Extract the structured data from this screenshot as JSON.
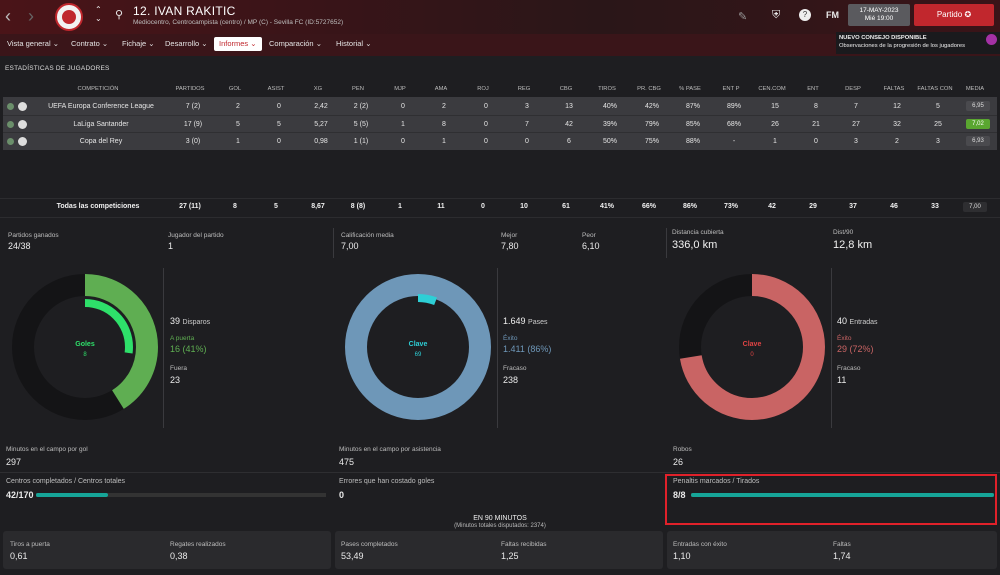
{
  "header": {
    "player_name": "12. IVAN RAKITIC",
    "player_sub": "Mediocentro, Centrocampista (centro) / MP (C) - Sevilla FC (ID:5727652)",
    "date_line1": "17-MAY-2023",
    "date_line2": "Mié 19:00",
    "partido_label": "Partido",
    "fm_label": "FM"
  },
  "menu": [
    {
      "label": "Vista general",
      "chev": "⌄"
    },
    {
      "label": "Contrato",
      "chev": "⌄"
    },
    {
      "label": "Fichaje",
      "chev": "⌄"
    },
    {
      "label": "Desarrollo",
      "chev": "⌄"
    },
    {
      "label": "Informes",
      "chev": "⌄"
    },
    {
      "label": "Comparación",
      "chev": "⌄"
    },
    {
      "label": "Historial",
      "chev": "⌄"
    }
  ],
  "consejo": {
    "title": "NUEVO CONSEJO DISPONIBLE",
    "text": "Observaciones de la progresión de los jugadores"
  },
  "section_title": "ESTADÍSTICAS DE JUGADORES",
  "columns": [
    "COMPETICIÓN",
    "PARTIDOS",
    "GOL",
    "ASIST",
    "XG",
    "PEN",
    "MJP",
    "AMA",
    "ROJ",
    "REG",
    "CBG",
    "TIROS",
    "PR. CBG",
    "% PASE",
    "ENT P",
    "CEN.COM",
    "ENT",
    "DESP",
    "FALTAS",
    "FALTAS CON",
    "MEDIA"
  ],
  "rows": [
    {
      "comp": "UEFA Europa Conference League",
      "vals": [
        "7 (2)",
        "2",
        "0",
        "2,42",
        "2 (2)",
        "0",
        "2",
        "0",
        "3",
        "13",
        "40%",
        "42%",
        "87%",
        "89%",
        "15",
        "8",
        "7",
        "12",
        "5"
      ],
      "media": "6,95",
      "media_color": "#4a4a4e"
    },
    {
      "comp": "LaLiga Santander",
      "vals": [
        "17 (9)",
        "5",
        "5",
        "5,27",
        "5 (5)",
        "1",
        "8",
        "0",
        "7",
        "42",
        "39%",
        "79%",
        "85%",
        "68%",
        "26",
        "21",
        "27",
        "32",
        "25"
      ],
      "media": "7,02",
      "media_color": "#5aa630"
    },
    {
      "comp": "Copa del Rey",
      "vals": [
        "3 (0)",
        "1",
        "0",
        "0,98",
        "1 (1)",
        "0",
        "1",
        "0",
        "0",
        "6",
        "50%",
        "75%",
        "88%",
        "-",
        "1",
        "0",
        "3",
        "2",
        "3"
      ],
      "media": "6,93",
      "media_color": "#4a4a4e"
    }
  ],
  "totals": {
    "label": "Todas las competiciones",
    "vals": [
      "27 (11)",
      "8",
      "5",
      "8,67",
      "8 (8)",
      "1",
      "11",
      "0",
      "10",
      "61",
      "41%",
      "66%",
      "86%",
      "73%",
      "42",
      "29",
      "37",
      "46",
      "33"
    ],
    "media": "7,00"
  },
  "panel1": {
    "s1_label": "Partidos ganados",
    "s1_val": "24/38",
    "s2_label": "Jugador del partido",
    "s2_val": "1",
    "donut_label": "Goles",
    "donut_val": "8",
    "stat_main": "39",
    "stat_main_label": "Disparos",
    "stat_a_label": "A puerta",
    "stat_a_val": "16 (41%)",
    "stat_b_label": "Fuera",
    "stat_b_val": "23",
    "bottom_label": "Minutos en el campo por gol",
    "bottom_val": "297",
    "fraction": 0.41
  },
  "panel2": {
    "s1_label": "Calificación media",
    "s1_val": "7,00",
    "s2_label": "Mejor",
    "s2_val": "7,80",
    "s3_label": "Peor",
    "s3_val": "6,10",
    "donut_label": "Clave",
    "donut_val": "69",
    "stat_main": "1.649",
    "stat_main_label": "Pases",
    "stat_a_label": "Éxito",
    "stat_a_val": "1.411 (86%)",
    "stat_b_label": "Fracaso",
    "stat_b_val": "238",
    "bottom_label": "Minutos en el campo por asistencia",
    "bottom_val": "475"
  },
  "panel3": {
    "s1_label": "Distancia cubierta",
    "s1_val": "336,0 km",
    "s2_label": "Dist/90",
    "s2_val": "12,8 km",
    "donut_label": "Clave",
    "donut_val": "0",
    "stat_main": "40",
    "stat_main_label": "Entradas",
    "stat_a_label": "Éxito",
    "stat_a_val": "29 (72%)",
    "stat_b_label": "Fracaso",
    "stat_b_val": "11",
    "bottom_label": "Robos",
    "bottom_val": "26"
  },
  "row2": {
    "c1_label": "Centros completados / Centros totales",
    "c1_val": "42/170",
    "c1_frac": 0.247,
    "c2_label": "Errores que han costado goles",
    "c2_val": "0",
    "c3_label": "Penaltis marcados / Tirados",
    "c3_val": "8/8",
    "c3_frac": 1.0
  },
  "per90": {
    "title": "EN 90 MINUTOS",
    "sub": "(Minutos totales disputados: 2374)"
  },
  "bottom": [
    {
      "label": "Tiros a puerta",
      "val": "0,61"
    },
    {
      "label": "Regates realizados",
      "val": "0,38"
    },
    {
      "label": "Pases completados",
      "val": "53,49"
    },
    {
      "label": "Faltas recibidas",
      "val": "1,25"
    },
    {
      "label": "Entradas con éxito",
      "val": "1,10"
    },
    {
      "label": "Faltas",
      "val": "1,74"
    }
  ],
  "colors": {
    "accent": "#c1272d",
    "green": "#5fae52",
    "green_light": "#2ee06a",
    "blue": "#6e97b8",
    "teal": "#2ecfd6",
    "red": "#c96464",
    "bar": "#16a598"
  }
}
